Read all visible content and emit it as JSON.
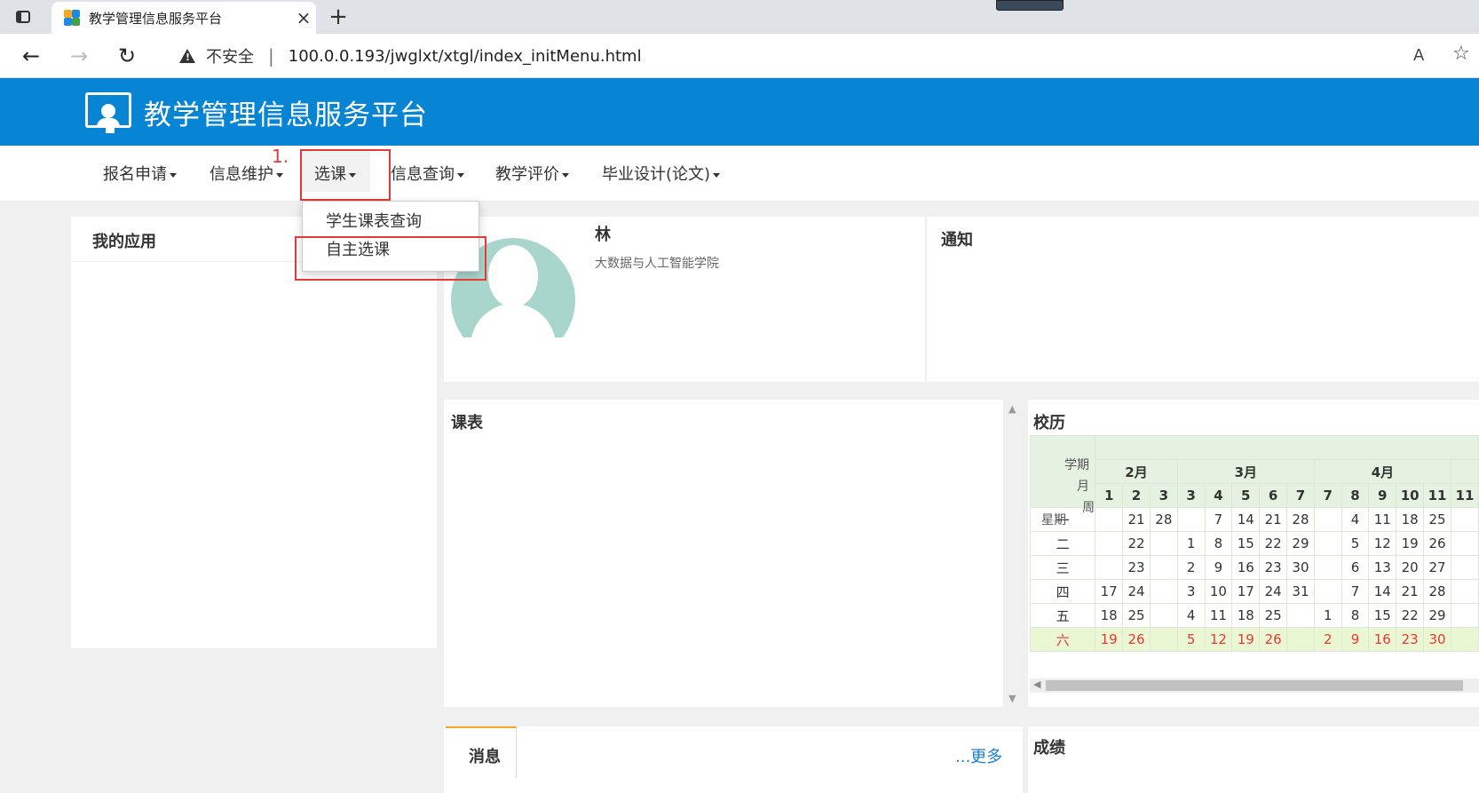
{
  "browser": {
    "tab_title": "教学管理信息服务平台",
    "tab_close": "×",
    "new_tab": "+",
    "back": "←",
    "forward": "→",
    "reload": "↻",
    "security_label": "不安全",
    "url_separator": "|",
    "url": "100.0.0.193/jwglxt/xtgl/index_initMenu.html",
    "read_aloud": "A",
    "favorite": "☆"
  },
  "header": {
    "title": "教学管理信息服务平台"
  },
  "nav": {
    "items": [
      {
        "label": "报名申请"
      },
      {
        "label": "信息维护"
      },
      {
        "label": "选课"
      },
      {
        "label": "信息查询"
      },
      {
        "label": "教学评价"
      },
      {
        "label": "毕业设计(论文)"
      }
    ],
    "step_label": "1.",
    "dropdown": [
      {
        "label": "学生课表查询"
      },
      {
        "label": "自主选课"
      }
    ]
  },
  "panels": {
    "my_apps": "我的应用",
    "user_name": "林",
    "user_dept": "大数据与人工智能学院",
    "notice": "通知",
    "schedule": "课表",
    "calendar": "校历",
    "messages": "消息",
    "more": "...更多",
    "grades": "成绩"
  },
  "calendar": {
    "label_term": "学期",
    "label_month": "月",
    "label_week": "周",
    "label_weekday": "星期",
    "months": [
      {
        "label": "2月",
        "span": 3
      },
      {
        "label": "3月",
        "span": 5
      },
      {
        "label": "4月",
        "span": 5
      }
    ],
    "weeks": [
      "1",
      "2",
      "3",
      "3",
      "4",
      "5",
      "6",
      "7",
      "7",
      "8",
      "9",
      "10",
      "11",
      "11"
    ],
    "rows": [
      {
        "day": "一",
        "cells": [
          "",
          "21",
          "28",
          "",
          "7",
          "14",
          "21",
          "28",
          "",
          "4",
          "11",
          "18",
          "25",
          ""
        ]
      },
      {
        "day": "二",
        "cells": [
          "",
          "22",
          "",
          "1",
          "8",
          "15",
          "22",
          "29",
          "",
          "5",
          "12",
          "19",
          "26",
          ""
        ]
      },
      {
        "day": "三",
        "cells": [
          "",
          "23",
          "",
          "2",
          "9",
          "16",
          "23",
          "30",
          "",
          "6",
          "13",
          "20",
          "27",
          ""
        ]
      },
      {
        "day": "四",
        "cells": [
          "17",
          "24",
          "",
          "3",
          "10",
          "17",
          "24",
          "31",
          "",
          "7",
          "14",
          "21",
          "28",
          ""
        ]
      },
      {
        "day": "五",
        "cells": [
          "18",
          "25",
          "",
          "4",
          "11",
          "18",
          "25",
          "",
          "1",
          "8",
          "15",
          "22",
          "29",
          ""
        ]
      },
      {
        "day": "六",
        "cells": [
          "19",
          "26",
          "",
          "5",
          "12",
          "19",
          "26",
          "",
          "2",
          "9",
          "16",
          "23",
          "30",
          ""
        ]
      }
    ]
  },
  "colors": {
    "brand": "#0785d4",
    "highlight": "#e53935",
    "calendar_header": "#e6f2e1",
    "saturday_row": "#eaf7d2",
    "link": "#1a7fd0"
  }
}
